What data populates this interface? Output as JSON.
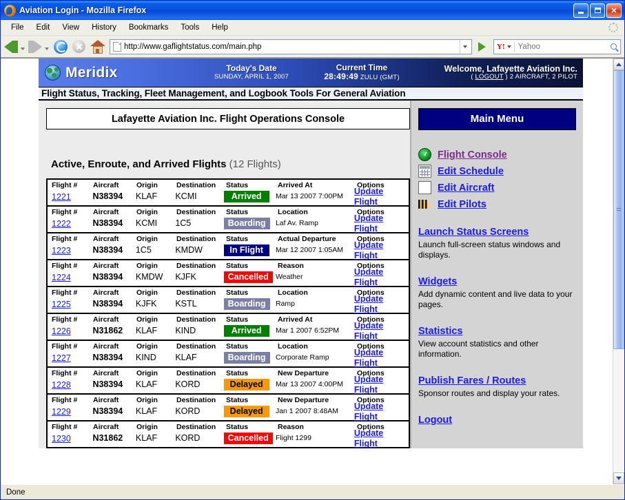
{
  "window": {
    "title": "Aviation Login - Mozilla Firefox",
    "minimize_label": "Minimize",
    "maximize_label": "Maximize",
    "close_label": "✕"
  },
  "menubar": {
    "items": [
      "File",
      "Edit",
      "View",
      "History",
      "Bookmarks",
      "Tools",
      "Help"
    ]
  },
  "toolbar": {
    "back_label": "Back",
    "forward_label": "Forward",
    "reload_label": "Reload",
    "stop_label": "Stop",
    "home_label": "Home",
    "url": "http://www.gaflightstatus.com/main.php",
    "go_label": "Go",
    "search_engine": "Yahoo",
    "search_value": "",
    "search_placeholder": "Yahoo"
  },
  "statusbar": {
    "text": "Done"
  },
  "site_header": {
    "brand": "Meridix",
    "date_label": "Today's Date",
    "date_value": "SUNDAY, APRIL 1, 2007",
    "time_label": "Current Time",
    "time_value": "28:49:49",
    "time_zone": "ZULU (GMT)",
    "welcome": "Welcome, Lafayette Aviation Inc.",
    "logout_prefix": "( ",
    "logout_label": "LOGOUT",
    "logout_suffix": " ) 2 AIRCRAFT, 2 PILOT",
    "tagline": "Flight Status, Tracking, Fleet Management, and Logbook Tools For General Aviation"
  },
  "main": {
    "console_title": "Lafayette Aviation Inc. Flight Operations Console",
    "flights_heading": "Active, Enroute, and Arrived Flights",
    "flights_count": "(12 Flights)",
    "columns": {
      "flight": "Flight #",
      "aircraft": "Aircraft",
      "origin": "Origin",
      "destination": "Destination",
      "status": "Status",
      "options": "Options"
    },
    "update_label": "Update Flight",
    "rows": [
      {
        "flight": "1221",
        "aircraft": "N38394",
        "origin": "KLAF",
        "destination": "KCMI",
        "status": "Arrived",
        "status_class": "arrived",
        "extra_header": "Arrived At",
        "extra": "Mar 13 2007 7:00PM",
        "options": "Update Flight"
      },
      {
        "flight": "1222",
        "aircraft": "N38394",
        "origin": "KCMI",
        "destination": "1C5",
        "status": "Boarding",
        "status_class": "boarding",
        "extra_header": "Location",
        "extra": "Laf Av. Ramp",
        "options": "Update Flight"
      },
      {
        "flight": "1223",
        "aircraft": "N38394",
        "origin": "1C5",
        "destination": "KMDW",
        "status": "In Flight",
        "status_class": "inflight",
        "extra_header": "Actual Departure",
        "extra": "Mar 12 2007 1:05AM",
        "options": "Update Flight"
      },
      {
        "flight": "1224",
        "aircraft": "N38394",
        "origin": "KMDW",
        "destination": "KJFK",
        "status": "Cancelled",
        "status_class": "cancelled",
        "extra_header": "Reason",
        "extra": "Weather",
        "options": "Update Flight"
      },
      {
        "flight": "1225",
        "aircraft": "N38394",
        "origin": "KJFK",
        "destination": "KSTL",
        "status": "Boarding",
        "status_class": "boarding",
        "extra_header": "Location",
        "extra": "Ramp",
        "options": "Update Flight"
      },
      {
        "flight": "1226",
        "aircraft": "N31862",
        "origin": "KLAF",
        "destination": "KIND",
        "status": "Arrived",
        "status_class": "arrived",
        "extra_header": "Arrived At",
        "extra": "Mar 1 2007 6:52PM",
        "options": "Update Flight"
      },
      {
        "flight": "1227",
        "aircraft": "N38394",
        "origin": "KIND",
        "destination": "KLAF",
        "status": "Boarding",
        "status_class": "boarding",
        "extra_header": "Location",
        "extra": "Corporate Ramp",
        "options": "Update Flight"
      },
      {
        "flight": "1228",
        "aircraft": "N38394",
        "origin": "KLAF",
        "destination": "KORD",
        "status": "Delayed",
        "status_class": "delayed",
        "extra_header": "New Departure",
        "extra": "Mar 13 2007 4:00PM",
        "options": "Update Flight"
      },
      {
        "flight": "1229",
        "aircraft": "N38394",
        "origin": "KLAF",
        "destination": "KORD",
        "status": "Delayed",
        "status_class": "delayed",
        "extra_header": "New Departure",
        "extra": "Jan 1 2007 8:48AM",
        "options": "Update Flight"
      },
      {
        "flight": "1230",
        "aircraft": "N31862",
        "origin": "KLAF",
        "destination": "KORD",
        "status": "Cancelled",
        "status_class": "cancelled",
        "extra_header": "Reason",
        "extra": "Flight 1299",
        "options": "Update Flight"
      }
    ]
  },
  "sidebar": {
    "title": "Main Menu",
    "links": [
      {
        "label": "Flight Console",
        "icon": "flight-console-icon",
        "icon_class": "console",
        "visited": true
      },
      {
        "label": "Edit Schedule",
        "icon": "calendar-icon",
        "icon_class": "sched",
        "visited": false
      },
      {
        "label": "Edit Aircraft",
        "icon": "airplane-icon",
        "icon_class": "plane",
        "visited": false
      },
      {
        "label": "Edit Pilots",
        "icon": "pilot-stripes-icon",
        "icon_class": "pilot",
        "visited": false
      }
    ],
    "sections": [
      {
        "heading": "Launch Status Screens",
        "desc": "Launch full-screen status windows and displays."
      },
      {
        "heading": "Widgets",
        "desc": "Add dynamic content and live data to your pages."
      },
      {
        "heading": "Statistics",
        "desc": "View account statistics and other information."
      },
      {
        "heading": "Publish Fares / Routes",
        "desc": "Sponsor routes and display your rates."
      },
      {
        "heading": "Logout",
        "desc": ""
      }
    ]
  },
  "colors": {
    "arrived": "#018000",
    "boarding": "#7b7fa8",
    "inflight": "#000080",
    "cancelled": "#fe0000",
    "delayed": "#f59a00",
    "menu_header": "#000080",
    "link": "#1a1aee",
    "visited_link": "#7a2a8c"
  }
}
